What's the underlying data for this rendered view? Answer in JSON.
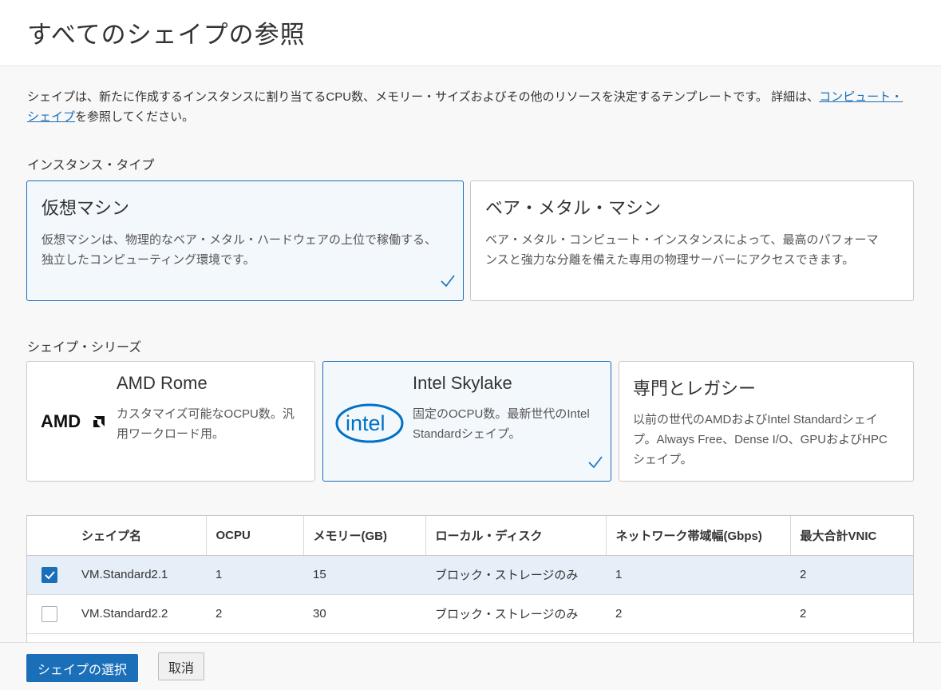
{
  "header": {
    "title": "すべてのシェイプの参照"
  },
  "intro": {
    "text_before": "シェイプは、新たに作成するインスタンスに割り当てるCPU数、メモリー・サイズおよびその他のリソースを決定するテンプレートです。 詳細は、",
    "link_text": "コンピュート・シェイプ",
    "text_after": "を参照してください。"
  },
  "instance_type": {
    "label": "インスタンス・タイプ",
    "options": [
      {
        "title": "仮想マシン",
        "description": "仮想マシンは、物理的なベア・メタル・ハードウェアの上位で稼働する、独立したコンピューティング環境です。",
        "selected": true
      },
      {
        "title": "ベア・メタル・マシン",
        "description": "ベア・メタル・コンピュート・インスタンスによって、最高のパフォーマンスと強力な分離を備えた専用の物理サーバーにアクセスできます。",
        "selected": false
      }
    ]
  },
  "shape_series": {
    "label": "シェイプ・シリーズ",
    "options": [
      {
        "title": "AMD Rome",
        "logo_text": "AMD",
        "description": "カスタマイズ可能なOCPU数。汎用ワークロード用。",
        "selected": false
      },
      {
        "title": "Intel Skylake",
        "logo_text": "intel",
        "description": "固定のOCPU数。最新世代のIntel Standardシェイプ。",
        "selected": true
      },
      {
        "title": "専門とレガシー",
        "description": "以前の世代のAMDおよびIntel Standardシェイプ。Always Free、Dense I/O、GPUおよびHPCシェイプ。",
        "selected": false
      }
    ]
  },
  "table": {
    "headers": [
      "",
      "シェイプ名",
      "OCPU",
      "メモリー(GB)",
      "ローカル・ディスク",
      "ネットワーク帯域幅(Gbps)",
      "最大合計VNIC"
    ],
    "rows": [
      {
        "checked": true,
        "cells": [
          "VM.Standard2.1",
          "1",
          "15",
          "ブロック・ストレージのみ",
          "1",
          "2"
        ]
      },
      {
        "checked": false,
        "cells": [
          "VM.Standard2.2",
          "2",
          "30",
          "ブロック・ストレージのみ",
          "2",
          "2"
        ]
      }
    ]
  },
  "footer": {
    "primary_label": "シェイプの選択",
    "cancel_label": "取消"
  },
  "colors": {
    "accent": "#1a6fb8",
    "selected_bg": "#f3f8fd",
    "row_selected_bg": "#e6eff8"
  }
}
